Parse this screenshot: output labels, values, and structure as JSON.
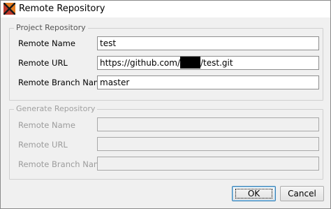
{
  "window": {
    "title": "Remote Repository",
    "icon": "app-logo-icon"
  },
  "project_group": {
    "legend": "Project Repository",
    "remote_name_label": "Remote Name",
    "remote_name_value": "test",
    "remote_url_label": "Remote URL",
    "remote_url_prefix": "https://github.com/",
    "remote_url_suffix": "/test.git",
    "remote_branch_label": "Remote Branch Name",
    "remote_branch_value": "master"
  },
  "generate_group": {
    "legend": "Generate Repository",
    "remote_name_label": "Remote Name",
    "remote_name_value": "",
    "remote_url_label": "Remote URL",
    "remote_url_value": "",
    "remote_branch_label": "Remote Branch Name",
    "remote_branch_value": ""
  },
  "buttons": {
    "ok_label": "OK",
    "cancel_label": "Cancel"
  }
}
